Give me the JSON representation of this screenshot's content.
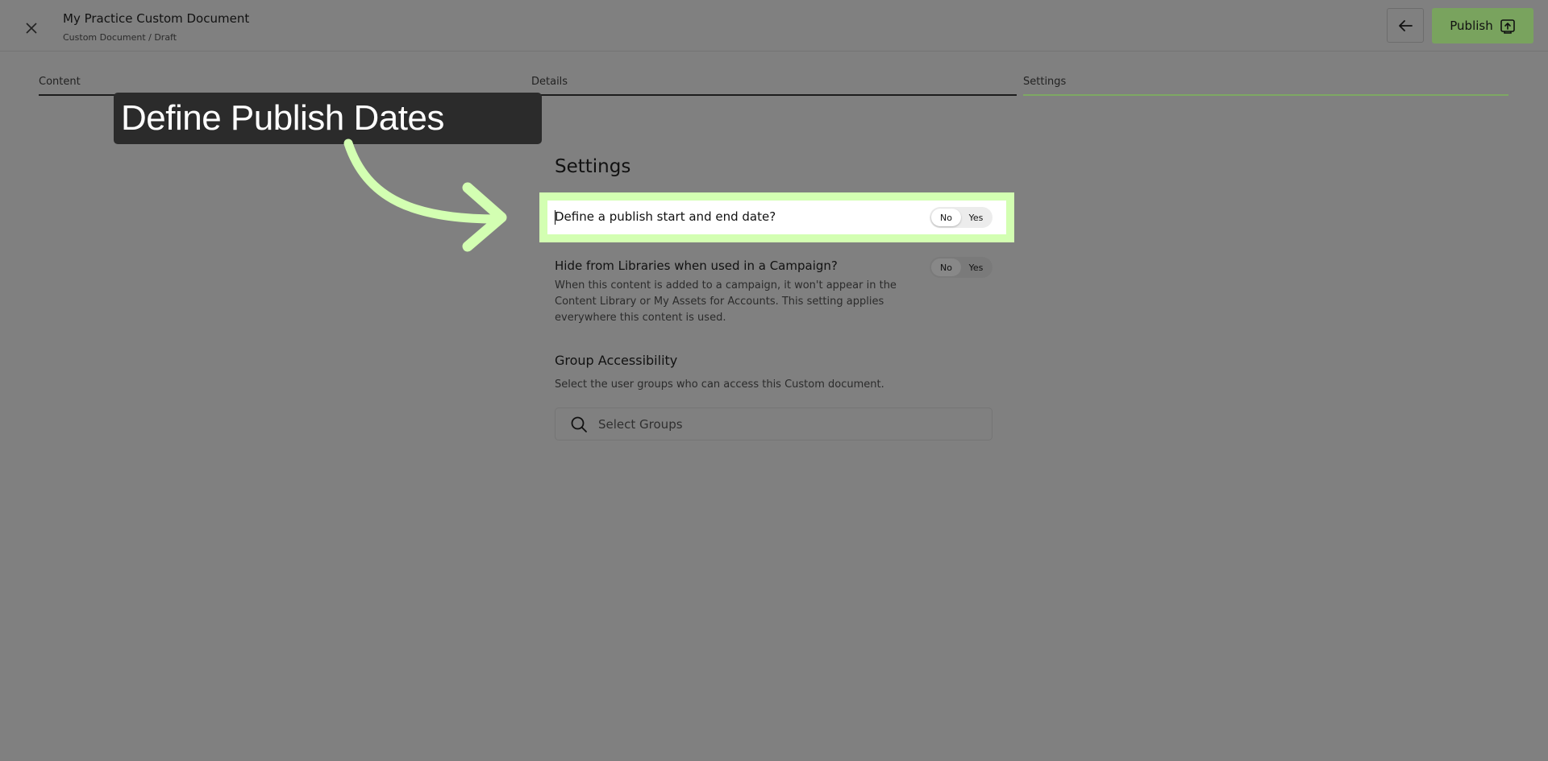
{
  "header": {
    "title": "My Practice Custom Document",
    "breadcrumb": "Custom Document / Draft",
    "publish_label": "Publish",
    "icons": {
      "close": "close-icon",
      "back": "arrow-left-icon",
      "publish": "publish-upload-icon"
    }
  },
  "tabs": [
    {
      "label": "Content"
    },
    {
      "label": "Details"
    },
    {
      "label": "Settings",
      "active": true
    }
  ],
  "callout": {
    "text": "Define Publish Dates"
  },
  "settings": {
    "title": "Settings",
    "items": [
      {
        "label": "Define a publish start and end date?",
        "options": [
          "No",
          "Yes"
        ],
        "selected": "No"
      },
      {
        "label": "Hide from Libraries when used in a Campaign?",
        "description": "When this content is added to a campaign, it won't appear in the Content Library or My Assets for Accounts. This setting applies everywhere this content is used.",
        "options": [
          "No",
          "Yes"
        ],
        "selected": "No"
      }
    ],
    "groups": {
      "title": "Group Accessibility",
      "description": "Select the user groups who can access this Custom document.",
      "placeholder": "Select Groups"
    }
  },
  "colors": {
    "overlay_background": "#808080",
    "publish_button": "#79a35e",
    "highlight": "#d3ffb2",
    "callout_bg": "#2b2b2b",
    "active_tab_line": "#7ea863"
  }
}
